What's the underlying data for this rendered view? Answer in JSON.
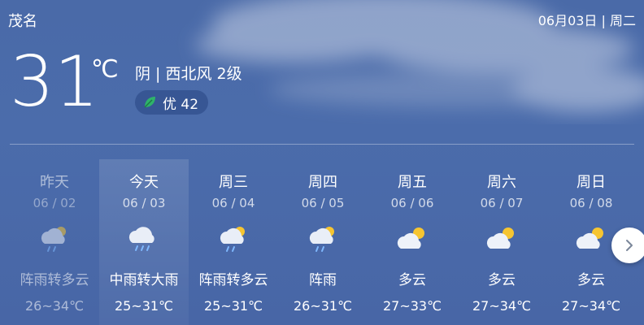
{
  "header": {
    "city": "茂名",
    "date": "06月03日 | 周二"
  },
  "current": {
    "temperature": "31",
    "unit": "℃",
    "condition": "阴 | 西北风 2级",
    "aqi_label": "优 42",
    "aqi_icon": "leaf-icon",
    "aqi_color": "#2fb36a"
  },
  "forecast": [
    {
      "name": "昨天",
      "date": "06 / 02",
      "icon": "rain-with-sun-icon",
      "desc": "阵雨转多云",
      "range": "26~34℃"
    },
    {
      "name": "今天",
      "date": "06 / 03",
      "icon": "heavy-rain-icon",
      "desc": "中雨转大雨",
      "range": "25~31℃"
    },
    {
      "name": "周三",
      "date": "06 / 04",
      "icon": "rain-with-sun-icon",
      "desc": "阵雨转多云",
      "range": "25~31℃"
    },
    {
      "name": "周四",
      "date": "06 / 05",
      "icon": "rain-with-sun-icon",
      "desc": "阵雨",
      "range": "26~31℃"
    },
    {
      "name": "周五",
      "date": "06 / 06",
      "icon": "partly-cloudy-icon",
      "desc": "多云",
      "range": "27~33℃"
    },
    {
      "name": "周六",
      "date": "06 / 07",
      "icon": "partly-cloudy-icon",
      "desc": "多云",
      "range": "27~34℃"
    },
    {
      "name": "周日",
      "date": "06 / 08",
      "icon": "partly-cloudy-icon",
      "desc": "多云",
      "range": "27~34℃"
    }
  ],
  "nav": {
    "next_icon": "chevron-right-icon"
  }
}
